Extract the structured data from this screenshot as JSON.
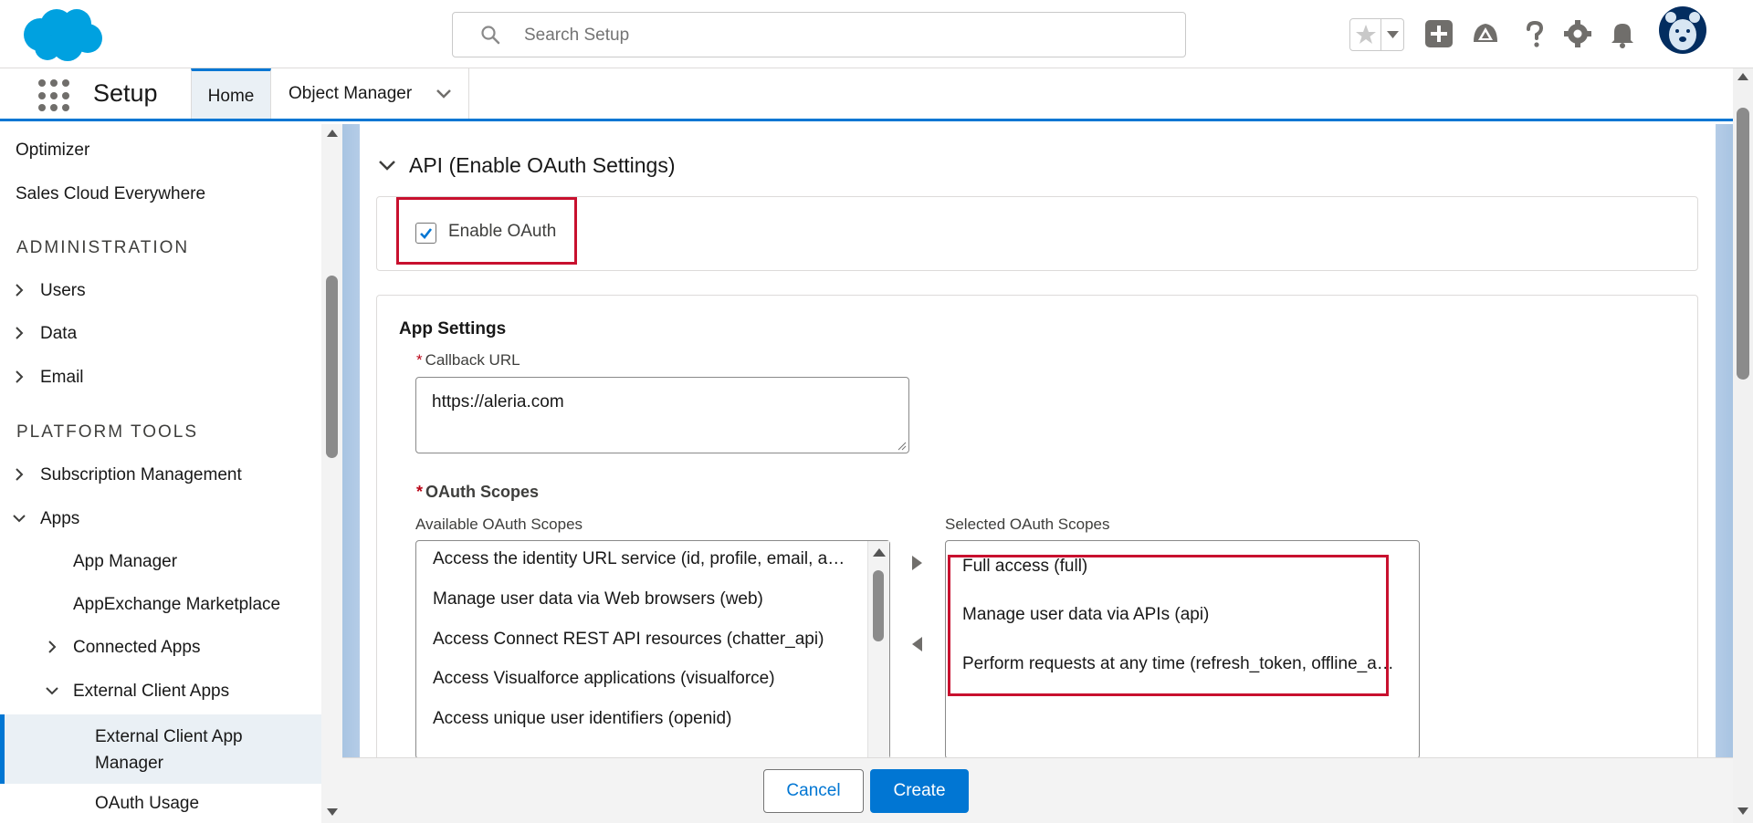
{
  "header": {
    "search_placeholder": "Search Setup"
  },
  "nav": {
    "app_name": "Setup",
    "tabs": [
      {
        "label": "Home",
        "active": true
      },
      {
        "label": "Object Manager",
        "active": false
      }
    ]
  },
  "sidebar": {
    "items": [
      {
        "label": "Optimizer"
      },
      {
        "label": "Sales Cloud Everywhere"
      },
      {
        "section": "ADMINISTRATION"
      },
      {
        "label": "Users",
        "expandable": true
      },
      {
        "label": "Data",
        "expandable": true
      },
      {
        "label": "Email",
        "expandable": true
      },
      {
        "section": "PLATFORM TOOLS"
      },
      {
        "label": "Subscription Management",
        "expandable": true
      },
      {
        "label": "Apps",
        "expanded": true
      },
      {
        "label": "App Manager"
      },
      {
        "label": "AppExchange Marketplace"
      },
      {
        "label": "Connected Apps",
        "expandable": true
      },
      {
        "label": "External Client Apps",
        "expanded": true
      },
      {
        "label": "External Client App Manager",
        "active": true
      },
      {
        "label": "OAuth Usage"
      }
    ]
  },
  "section": {
    "title": "API (Enable OAuth Settings)"
  },
  "enable_oauth": {
    "label": "Enable OAuth",
    "checked": true
  },
  "app_settings": {
    "heading": "App Settings",
    "callback_label": "Callback URL",
    "callback_value": "https://aleria.com",
    "scopes_label": "OAuth Scopes",
    "available_label": "Available OAuth Scopes",
    "selected_label": "Selected OAuth Scopes",
    "available_scopes": [
      "Access the identity URL service (id, profile, email, address, phone)",
      "Manage user data via Web browsers (web)",
      "Access Connect REST API resources (chatter_api)",
      "Access Visualforce applications (visualforce)",
      "Access unique user identifiers (openid)"
    ],
    "selected_scopes": [
      "Full access (full)",
      "Manage user data via APIs (api)",
      "Perform requests at any time (refresh_token, offline_access)"
    ]
  },
  "footer": {
    "cancel_label": "Cancel",
    "create_label": "Create"
  },
  "colors": {
    "brand": "#0176d3",
    "highlight": "#c8102e"
  }
}
